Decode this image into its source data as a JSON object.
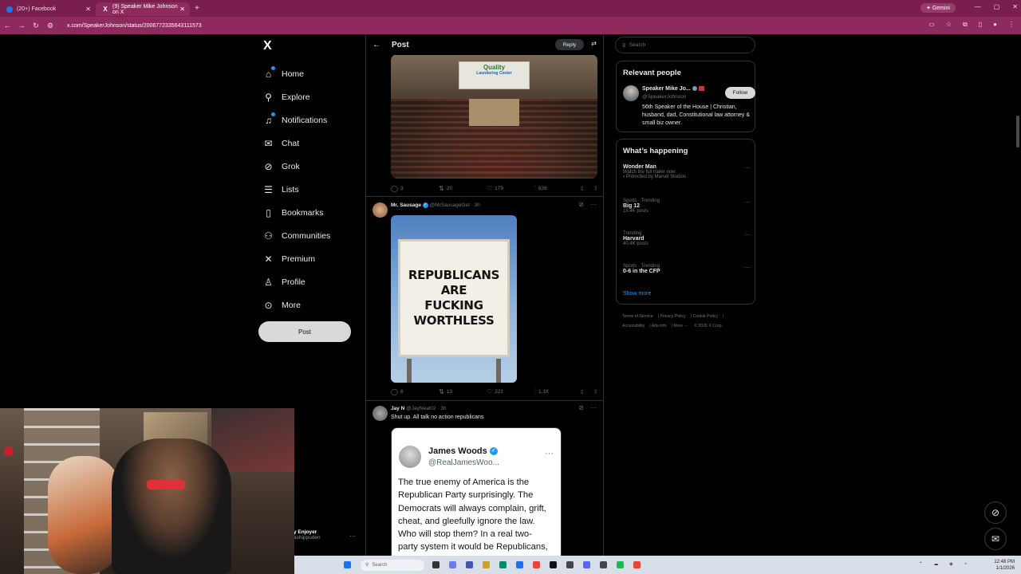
{
  "browser": {
    "tabs": [
      {
        "label": "(20+) Facebook"
      },
      {
        "label": "(9) Speaker Mike Johnson on X"
      }
    ],
    "gemini_label": "Gemini",
    "url": "x.com/SpeakerJohnson/status/2006772335643111573"
  },
  "nav": {
    "logo": "X",
    "items": [
      {
        "label": "Home",
        "icon": "home-icon"
      },
      {
        "label": "Explore",
        "icon": "search-icon"
      },
      {
        "label": "Notifications",
        "icon": "bell-icon"
      },
      {
        "label": "Chat",
        "icon": "mail-icon"
      },
      {
        "label": "Grok",
        "icon": "grok-icon"
      },
      {
        "label": "Lists",
        "icon": "list-icon"
      },
      {
        "label": "Bookmarks",
        "icon": "bookmark-icon"
      },
      {
        "label": "Communities",
        "icon": "people-icon"
      },
      {
        "label": "Premium",
        "icon": "x-icon"
      },
      {
        "label": "Profile",
        "icon": "person-icon"
      },
      {
        "label": "More",
        "icon": "more-icon"
      }
    ],
    "post_label": "Post",
    "account": {
      "name": "y Enjoyer",
      "handle": "ashippuden"
    }
  },
  "header": {
    "title": "Post",
    "reply_label": "Reply"
  },
  "post1": {
    "image_sign_title": "Quality",
    "image_sign_sub": "Laundering Center",
    "stats": {
      "replies": "3",
      "reposts": "20",
      "likes": "179",
      "views": "636"
    }
  },
  "reply1": {
    "name": "Mr. Sausage",
    "handle": "@MrSausageGet",
    "time": "· 3h",
    "sign_lines": [
      "REPUBLICANS",
      "ARE",
      "FUCKING",
      "WORTHLESS"
    ],
    "stats": {
      "replies": "6",
      "reposts": "13",
      "likes": "221",
      "views": "1.1K"
    }
  },
  "reply2": {
    "name": "Jay N",
    "handle": "@JayNeal02",
    "time": "· 3h",
    "text": "Shut up. All talk no action republicans",
    "quote": {
      "name": "James Woods",
      "handle": "@RealJamesWoo...",
      "lines": [
        "The true enemy of America is the",
        "Republican Party surprisingly. The",
        "Democrats will always complain, grift,",
        "cheat, and gleefully ignore the law.",
        "Who will stop them? In a real two-",
        "party system it would be Republicans,"
      ]
    }
  },
  "right": {
    "search_placeholder": "Search",
    "relevant": {
      "title": "Relevant people",
      "name": "Speaker Mike Jo...",
      "handle": "@SpeakerJohnson",
      "follow_label": "Follow",
      "bio": "56th Speaker of the House | Christian, husband, dad, Constitutional law attorney & small biz owner."
    },
    "happening": {
      "title": "What’s happening",
      "trends": [
        {
          "meta": "",
          "title": "Wonder Man",
          "sub": "Watch the full trailer now",
          "sub2": "Promoted by Marvel Studios"
        },
        {
          "meta": "Sports · Trending",
          "title": "Big 12",
          "sub": "15.4K posts",
          "sub2": ""
        },
        {
          "meta": "Trending",
          "title": "Harvard",
          "sub": "40.4K posts",
          "sub2": ""
        },
        {
          "meta": "Sports · Trending",
          "title": "0-6 in the CFP",
          "sub": "",
          "sub2": ""
        }
      ],
      "show_more": "Show more"
    },
    "footer": [
      "Terms of Service",
      "Privacy Policy",
      "Cookie Policy",
      "Accessibility",
      "Ads info",
      "More ···",
      "© 2026 X Corp."
    ]
  },
  "taskbar": {
    "search_placeholder": "Search",
    "time": "12:48 PM",
    "date": "1/1/2026"
  }
}
